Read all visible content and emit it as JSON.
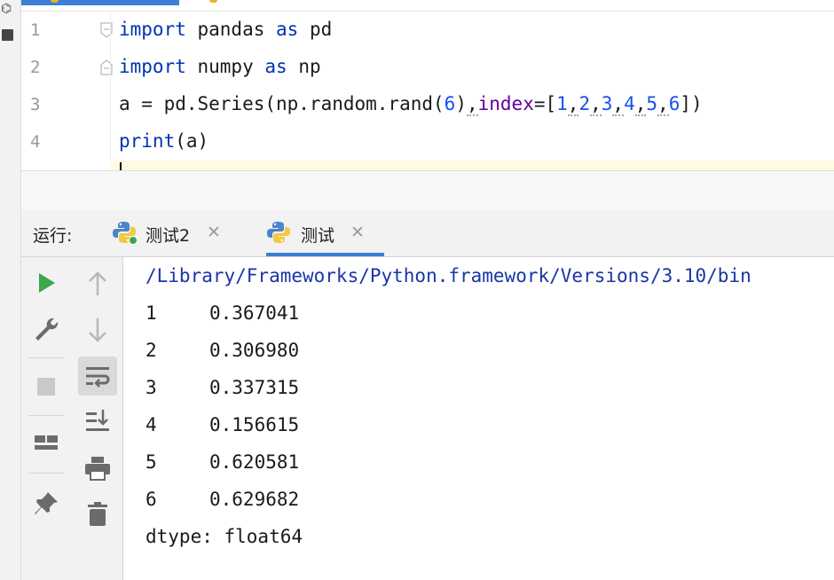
{
  "editor": {
    "line_numbers": [
      "1",
      "2",
      "3",
      "4"
    ],
    "lines": [
      {
        "t1": "import",
        "t2": " pandas ",
        "t3": "as",
        "t4": " pd"
      },
      {
        "t1": "import",
        "t2": " numpy ",
        "t3": "as",
        "t4": " np"
      },
      {
        "p1": "a = pd.Series(np.random.rand(",
        "n6": "6",
        "p2": ")",
        "c1": ",",
        "param": "index",
        "p3": "=[",
        "a1": "1",
        "a2": "2",
        "a3": "3",
        "a4": "4",
        "a5": "5",
        "a6": "6",
        "p4": "])"
      },
      {
        "t1": "print",
        "t2": "(a)"
      }
    ]
  },
  "run": {
    "label": "运行:",
    "tabs": [
      {
        "label": "测试2",
        "close": "✕"
      },
      {
        "label": "测试",
        "close": "✕"
      }
    ]
  },
  "console": {
    "path": "/Library/Frameworks/Python.framework/Versions/3.10/bin",
    "rows": [
      {
        "index": "1",
        "value": "0.367041"
      },
      {
        "index": "2",
        "value": "0.306980"
      },
      {
        "index": "3",
        "value": "0.337315"
      },
      {
        "index": "4",
        "value": "0.156615"
      },
      {
        "index": "5",
        "value": "0.620581"
      },
      {
        "index": "6",
        "value": "0.629682"
      }
    ],
    "dtype": "dtype: float64"
  },
  "icons": {
    "run": "play-icon",
    "wrench": "wrench-icon",
    "stop": "stop-icon",
    "layout": "layout-icon",
    "pin": "pin-icon",
    "up": "arrow-up-icon",
    "down": "arrow-down-icon",
    "wrap": "soft-wrap-icon",
    "scroll": "scroll-to-end-icon",
    "print": "print-icon",
    "trash": "trash-icon"
  },
  "colors": {
    "accent": "#3d7ed8",
    "keyword": "#0033b3",
    "number": "#1750eb",
    "param": "#660099",
    "run_green": "#3fa64e",
    "path": "#1a35a8"
  }
}
